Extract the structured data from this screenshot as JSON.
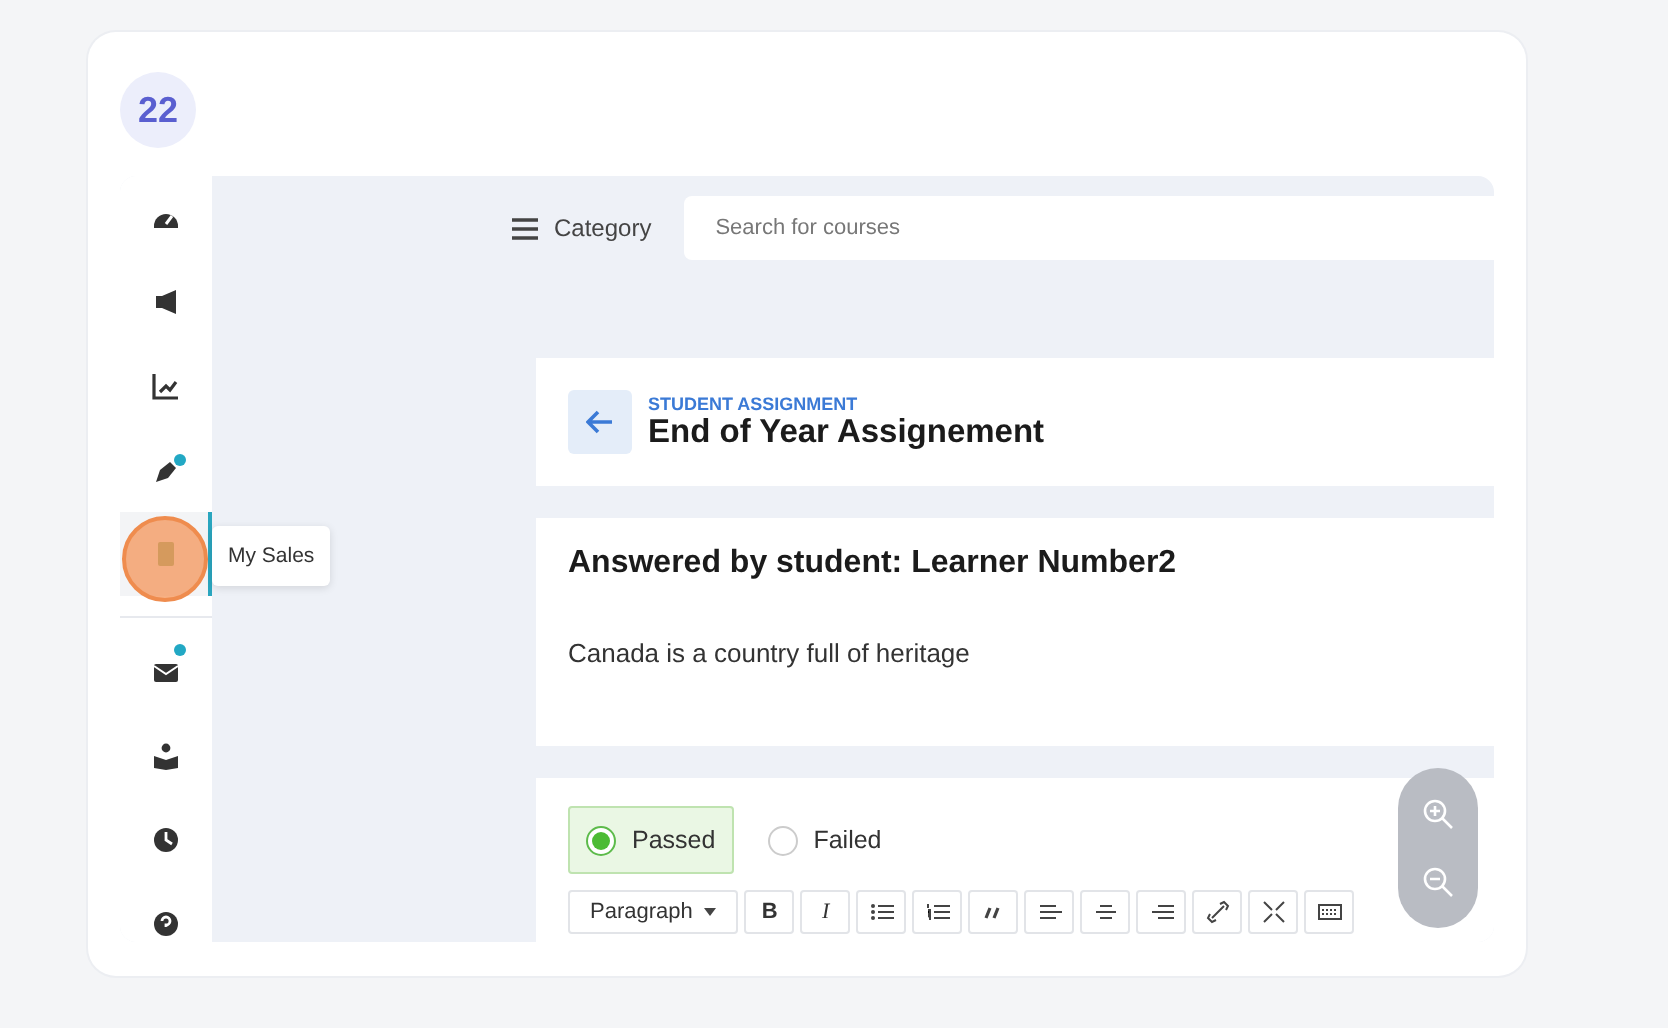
{
  "step_badge": "22",
  "sidebar": {
    "items": [
      {
        "kind": "gauge",
        "notify": false,
        "selected": false
      },
      {
        "kind": "megaphone",
        "notify": false,
        "selected": false
      },
      {
        "kind": "chart",
        "notify": false,
        "selected": false
      },
      {
        "kind": "pen",
        "notify": true,
        "selected": false
      },
      {
        "kind": "document",
        "notify": false,
        "selected": true
      },
      {
        "kind": "mail",
        "notify": true,
        "selected": false
      },
      {
        "kind": "reader",
        "notify": false,
        "selected": false
      },
      {
        "kind": "clock",
        "notify": false,
        "selected": false
      },
      {
        "kind": "help",
        "notify": false,
        "selected": false
      }
    ],
    "tooltip": "My Sales"
  },
  "header": {
    "category": "Category",
    "search": {
      "placeholder": "Search for courses"
    }
  },
  "assignment": {
    "eyebrow": "STUDENT ASSIGNMENT",
    "title": "End of Year Assignement"
  },
  "answer": {
    "heading": "Answered by student: Learner Number2",
    "text": "Canada is a country full of heritage"
  },
  "grading": {
    "options": [
      {
        "label": "Passed",
        "selected": true
      },
      {
        "label": "Failed",
        "selected": false
      }
    ]
  },
  "toolbar": [
    {
      "kind": "dropdown",
      "label": "Paragraph"
    },
    {
      "kind": "bold",
      "label": "B"
    },
    {
      "kind": "italic",
      "label": "I"
    },
    {
      "kind": "bulleted-list"
    },
    {
      "kind": "numbered-list"
    },
    {
      "kind": "quote"
    },
    {
      "kind": "align-left"
    },
    {
      "kind": "align-center"
    },
    {
      "kind": "align-right"
    },
    {
      "kind": "link"
    },
    {
      "kind": "expand"
    },
    {
      "kind": "keyboard"
    }
  ]
}
